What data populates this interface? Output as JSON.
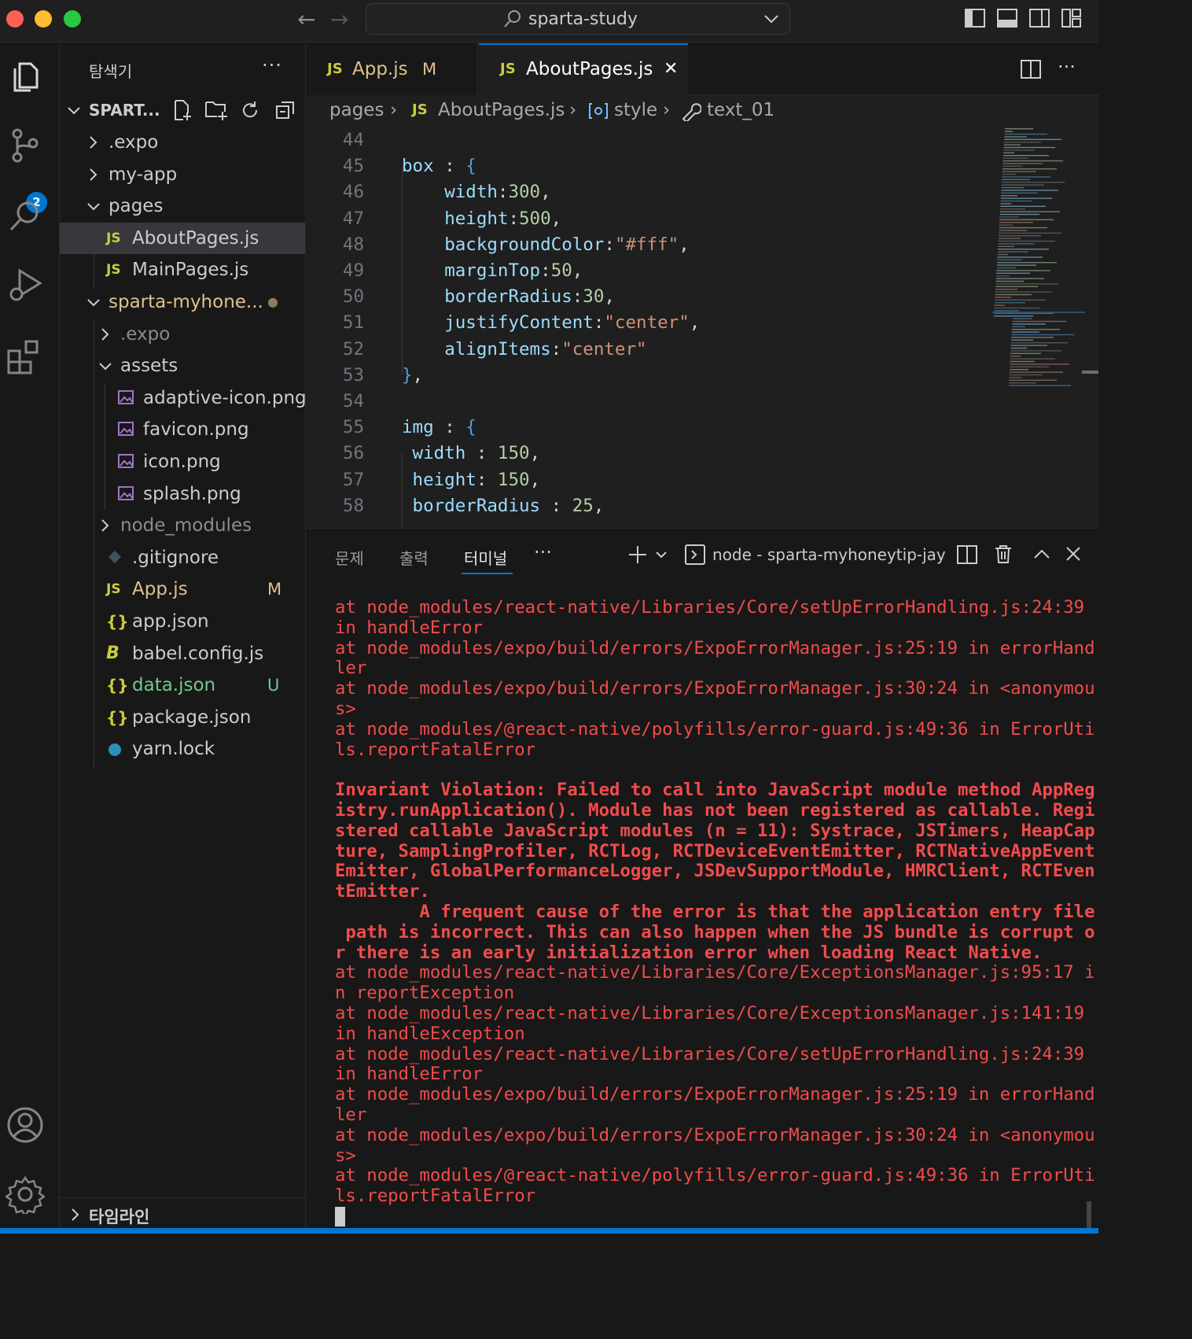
{
  "title_bar": {
    "search_label": "sparta-study"
  },
  "activity_bar": {
    "icons": [
      "explorer-icon",
      "source-control-icon",
      "search-icon",
      "run-debug-icon",
      "extensions-icon",
      "account-icon",
      "settings-gear-icon"
    ],
    "source_control_badge": "2"
  },
  "sidebar": {
    "title": "탐색기",
    "more": "···",
    "root_folder": "SPART...",
    "timeline": "타임라인",
    "items": [
      {
        "label": ".expo",
        "kind": "folder",
        "expanded": false,
        "status": ""
      },
      {
        "label": "my-app",
        "kind": "folder",
        "expanded": false,
        "status": ""
      },
      {
        "label": "pages",
        "kind": "folder",
        "expanded": true,
        "status": ""
      },
      {
        "label": "AboutPages.js",
        "kind": "js",
        "status": "",
        "selected": true
      },
      {
        "label": "MainPages.js",
        "kind": "js",
        "status": ""
      },
      {
        "label": "sparta-myhone...",
        "kind": "folder",
        "expanded": true,
        "status": "●"
      },
      {
        "label": ".expo",
        "kind": "folder",
        "expanded": false,
        "status": ""
      },
      {
        "label": "assets",
        "kind": "folder",
        "expanded": true,
        "status": ""
      },
      {
        "label": "adaptive-icon.png",
        "kind": "image",
        "status": ""
      },
      {
        "label": "favicon.png",
        "kind": "image",
        "status": ""
      },
      {
        "label": "icon.png",
        "kind": "image",
        "status": ""
      },
      {
        "label": "splash.png",
        "kind": "image",
        "status": ""
      },
      {
        "label": "node_modules",
        "kind": "folder",
        "expanded": false,
        "status": ""
      },
      {
        "label": ".gitignore",
        "kind": "git",
        "status": ""
      },
      {
        "label": "App.js",
        "kind": "js",
        "status": "M"
      },
      {
        "label": "app.json",
        "kind": "json",
        "status": ""
      },
      {
        "label": "babel.config.js",
        "kind": "babel",
        "status": ""
      },
      {
        "label": "data.json",
        "kind": "json",
        "status": "U"
      },
      {
        "label": "package.json",
        "kind": "json",
        "status": ""
      },
      {
        "label": "yarn.lock",
        "kind": "yarn",
        "status": ""
      }
    ],
    "json_glyph": "{}",
    "js_glyph": "JS"
  },
  "tabs": [
    {
      "label": "App.js",
      "badge": "JS",
      "status": "M"
    },
    {
      "label": "AboutPages.js",
      "badge": "JS",
      "close": "✕"
    }
  ],
  "breadcrumb": {
    "items": [
      "pages",
      "AboutPages.js",
      "style",
      "text_01"
    ],
    "sep": "›"
  },
  "code": {
    "line_numbers": [
      "44",
      "45",
      "46",
      "47",
      "48",
      "49",
      "50",
      "51",
      "52",
      "53",
      "54",
      "55",
      "56",
      "57",
      "58"
    ],
    "lines": [
      "",
      "box : {",
      "    width:300,",
      "    height:500,",
      "    backgroundColor:\"#fff\",",
      "    marginTop:50,",
      "    borderRadius:30,",
      "    justifyContent:\"center\",",
      "    alignItems:\"center\"",
      "},",
      "",
      "img : {",
      " width : 150,",
      " height: 150,",
      " borderRadius : 25,"
    ]
  },
  "panel": {
    "tabs": [
      "문제",
      "출력",
      "터미널"
    ],
    "more": "···",
    "terminal_name": "node - sparta-myhoneytip-jay",
    "terminal_lines": [
      {
        "t": "at node_modules/react-native/Libraries/Core/setUpErrorHandling.js:24:39",
        "b": false
      },
      {
        "t": "in handleError",
        "b": false
      },
      {
        "t": "at node_modules/expo/build/errors/ExpoErrorManager.js:25:19 in errorHand",
        "b": false
      },
      {
        "t": "ler",
        "b": false
      },
      {
        "t": "at node_modules/expo/build/errors/ExpoErrorManager.js:30:24 in <anonymou",
        "b": false
      },
      {
        "t": "s>",
        "b": false
      },
      {
        "t": "at node_modules/@react-native/polyfills/error-guard.js:49:36 in ErrorUti",
        "b": false
      },
      {
        "t": "ls.reportFatalError",
        "b": false
      },
      {
        "t": "",
        "b": false
      },
      {
        "t": "Invariant Violation: Failed to call into JavaScript module method AppReg",
        "b": true
      },
      {
        "t": "istry.runApplication(). Module has not been registered as callable. Regi",
        "b": true
      },
      {
        "t": "stered callable JavaScript modules (n = 11): Systrace, JSTimers, HeapCap",
        "b": true
      },
      {
        "t": "ture, SamplingProfiler, RCTLog, RCTDeviceEventEmitter, RCTNativeAppEvent",
        "b": true
      },
      {
        "t": "Emitter, GlobalPerformanceLogger, JSDevSupportModule, HMRClient, RCTEven",
        "b": true
      },
      {
        "t": "tEmitter.",
        "b": true
      },
      {
        "t": "        A frequent cause of the error is that the application entry file",
        "b": true
      },
      {
        "t": " path is incorrect. This can also happen when the JS bundle is corrupt o",
        "b": true
      },
      {
        "t": "r there is an early initialization error when loading React Native.",
        "b": true
      },
      {
        "t": "at node_modules/react-native/Libraries/Core/ExceptionsManager.js:95:17 i",
        "b": false
      },
      {
        "t": "n reportException",
        "b": false
      },
      {
        "t": "at node_modules/react-native/Libraries/Core/ExceptionsManager.js:141:19",
        "b": false
      },
      {
        "t": "in handleException",
        "b": false
      },
      {
        "t": "at node_modules/react-native/Libraries/Core/setUpErrorHandling.js:24:39",
        "b": false
      },
      {
        "t": "in handleError",
        "b": false
      },
      {
        "t": "at node_modules/expo/build/errors/ExpoErrorManager.js:25:19 in errorHand",
        "b": false
      },
      {
        "t": "ler",
        "b": false
      },
      {
        "t": "at node_modules/expo/build/errors/ExpoErrorManager.js:30:24 in <anonymou",
        "b": false
      },
      {
        "t": "s>",
        "b": false
      },
      {
        "t": "at node_modules/@react-native/polyfills/error-guard.js:49:36 in ErrorUti",
        "b": false
      },
      {
        "t": "ls.reportFatalError",
        "b": false
      }
    ]
  },
  "colors": {
    "accent": "#0078d4",
    "error_text": "#f14c4c",
    "modified": "#e2c08d",
    "untracked": "#73c991"
  }
}
